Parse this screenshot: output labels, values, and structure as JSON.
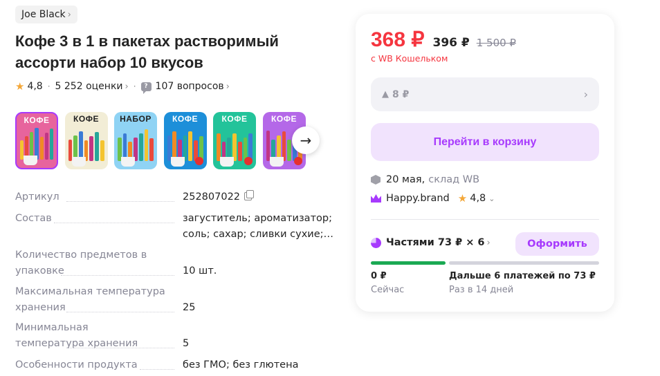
{
  "brand": {
    "name": "Joe Black"
  },
  "product": {
    "title": "Кофе 3 в 1 в пакетах растворимый ассорти набор 10 вкусов",
    "rating": "4,8",
    "reviews": "5 252 оценки",
    "questions": "107 вопросов"
  },
  "gallery": {
    "thumbnails": [
      {
        "label": "КОФЕ",
        "bg": "#e7649d",
        "active": true
      },
      {
        "label": "КОФЕ",
        "bg": "#f2edd6"
      },
      {
        "label": "НАБОР",
        "bg": "#8fd3f4"
      },
      {
        "label": "КОФЕ",
        "bg": "#1d8fd9"
      },
      {
        "label": "КОФЕ",
        "bg": "#23c39a"
      },
      {
        "label": "КОФЕ",
        "bg": "#b468e8"
      }
    ],
    "next_icon": "arrow-right-icon"
  },
  "specs": [
    {
      "name": "Артикул",
      "value": "252807022",
      "copy": true
    },
    {
      "name": "Состав",
      "value": "загуститель; ароматизатор; соль; сахар; сливки сухие;…"
    },
    {
      "name": "Количество предметов в упаковке",
      "value": "10 шт."
    },
    {
      "name": "Максимальная температура хранения",
      "value": "25"
    },
    {
      "name": "Минимальная температура хранения",
      "value": "5"
    },
    {
      "name": "Особенности продукта",
      "value": "без ГМО; без глютена"
    }
  ],
  "buy_card": {
    "price": "368 ₽",
    "price_regular": "396 ₽",
    "price_old": "1 500 ₽",
    "wallet_note": "с WB Кошельком",
    "price_drop": "8 ₽",
    "cart_button": "Перейти в корзину",
    "delivery_date": "20 мая,",
    "delivery_source": "склад WB",
    "seller": "Happy.brand",
    "seller_rating": "4,8",
    "installments": "Частями 73 ₽ × 6",
    "checkout_button": "Оформить",
    "pay_now_amount": "0 ₽",
    "pay_now_label": "Сейчас",
    "pay_later_amount": "Дальше 6 платежей по 73 ₽",
    "pay_later_label": "Раз в 14 дней"
  },
  "colors": {
    "accent": "#a73afd",
    "price": "#f5353f",
    "progress_now": "#1aa953",
    "progress_later": "#d4d4dc"
  }
}
